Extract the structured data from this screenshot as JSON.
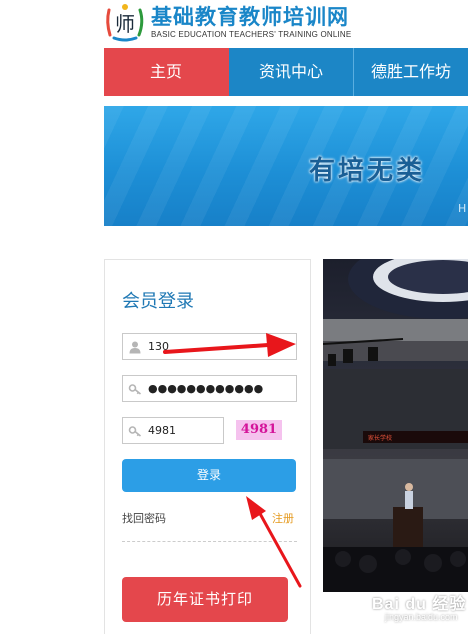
{
  "header": {
    "title": "基础教育教师培训网",
    "subtitle": "BASIC EDUCATION TEACHERS' TRAINING ONLINE",
    "logo_text": "师"
  },
  "nav": {
    "items": [
      {
        "label": "主页",
        "active": true
      },
      {
        "label": "资讯中心",
        "active": false
      },
      {
        "label": "德胜工作坊",
        "active": false
      }
    ]
  },
  "banner": {
    "slogan": "有培无类",
    "edge_letter": "H"
  },
  "login": {
    "title": "会员登录",
    "username_value": "130",
    "password_masked": "●●●●●●●●●●●●",
    "captcha_input": "4981",
    "captcha_image_text": "4981",
    "login_label": "登录",
    "forgot_label": "找回密码",
    "register_label": "注册",
    "print_label": "历年证书打印"
  },
  "photo": {
    "screen_text": "家长学校"
  },
  "watermark": {
    "brand": "Bai du 经验",
    "url": "jingyan.baidu.com"
  },
  "colors": {
    "nav_blue": "#1c86c6",
    "nav_active_red": "#e4474c",
    "title_blue": "#1a86c8",
    "button_blue": "#2c9ee6",
    "register_orange": "#e59a1f",
    "annotation_red": "#e8161b"
  },
  "icons": {
    "username_field": "user-icon",
    "password_field": "key-icon",
    "captcha_field": "key-icon"
  }
}
